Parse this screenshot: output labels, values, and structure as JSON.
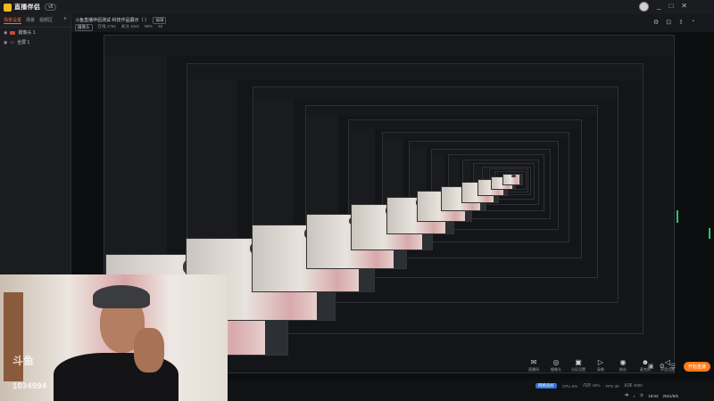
{
  "app": {
    "logo_text": "直播伴侣",
    "version_chip": "v5",
    "window_controls": [
      "_",
      "□",
      "✕"
    ]
  },
  "left_panel": {
    "tabs": [
      {
        "label": "场景设置",
        "active": true
      },
      {
        "label": "场景",
        "active": false
      },
      {
        "label": "视频区",
        "active": false
      }
    ],
    "add_label": "+",
    "sources": [
      {
        "label": "摄像头 1"
      },
      {
        "label": "全屏 1"
      }
    ]
  },
  "header": {
    "room_title": "斗鱼直播伴侣测试·科技作品展示（ ）",
    "edit_label": "编辑",
    "category": "摄像头",
    "meta": [
      "在线 1754",
      "关注 1042",
      "98%",
      "28"
    ],
    "icons": [
      "gear-icon",
      "lock-icon",
      "share-icon",
      "bell-icon"
    ]
  },
  "overlay": {
    "platform_logo": "斗鱼",
    "room_number": "1034994"
  },
  "toolbar": {
    "tools": [
      {
        "icon": "✉",
        "label": "直播间"
      },
      {
        "icon": "◎",
        "label": "摄像头"
      },
      {
        "icon": "▣",
        "label": "分区设置"
      },
      {
        "icon": "▷",
        "label": "录像"
      },
      {
        "icon": "◉",
        "label": "粉丝"
      },
      {
        "icon": "☻",
        "label": "麦克风"
      },
      {
        "icon": "◁",
        "label": "声音设置"
      }
    ],
    "small_icons": [
      "▣",
      "⚙",
      "☰"
    ],
    "live_button": "开始直播"
  },
  "status": {
    "network": "网络良好",
    "items": [
      "CPU 6%",
      "内存 42%",
      "FPS 30",
      "码率 4000"
    ]
  },
  "taskbar": {
    "items": [
      "中",
      "♪",
      "ⓦ"
    ],
    "time": "18:53",
    "date": "2021/6/5"
  }
}
